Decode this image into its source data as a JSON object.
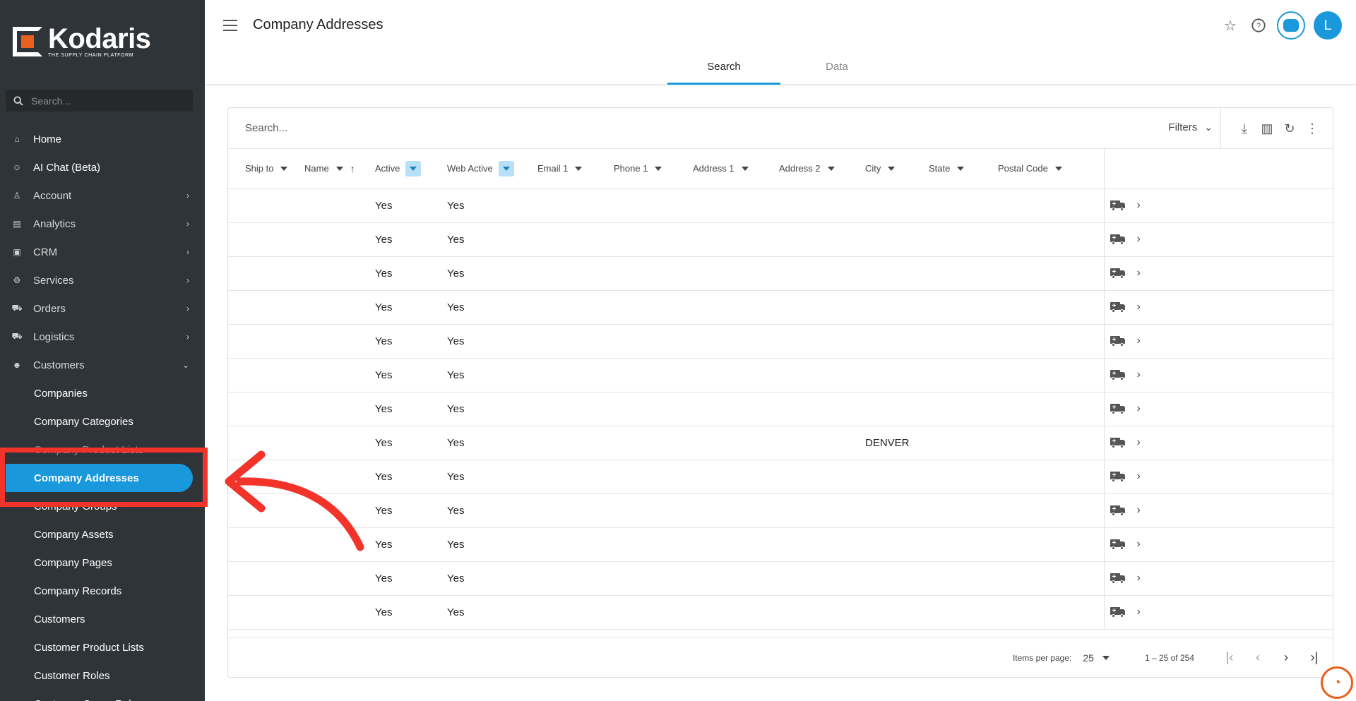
{
  "brand": {
    "name": "Kodaris",
    "tagline": "THE SUPPLY CHAIN PLATFORM",
    "accent": "#1a98dc",
    "logo_orange": "#e8611c"
  },
  "sidebar": {
    "search_placeholder": "Search...",
    "items": [
      {
        "label": "Home",
        "icon": "home-icon",
        "chevron": false
      },
      {
        "label": "AI Chat (Beta)",
        "icon": "robot-icon",
        "chevron": false
      },
      {
        "label": "Account",
        "icon": "person-icon",
        "chevron": true
      },
      {
        "label": "Analytics",
        "icon": "analytics-icon",
        "chevron": true
      },
      {
        "label": "CRM",
        "icon": "contact-icon",
        "chevron": true
      },
      {
        "label": "Services",
        "icon": "gears-icon",
        "chevron": true
      },
      {
        "label": "Orders",
        "icon": "truck-icon",
        "chevron": true
      },
      {
        "label": "Logistics",
        "icon": "shipping-icon",
        "chevron": true
      },
      {
        "label": "Customers",
        "icon": "people-icon",
        "chevron": true,
        "expanded": true
      }
    ],
    "sub_items": [
      {
        "label": "Companies"
      },
      {
        "label": "Company Categories"
      },
      {
        "label": "Company Product Lists"
      },
      {
        "label": "Company Addresses",
        "active": true
      },
      {
        "label": "Company Groups"
      },
      {
        "label": "Company Assets"
      },
      {
        "label": "Company Pages"
      },
      {
        "label": "Company Records"
      },
      {
        "label": "Customers"
      },
      {
        "label": "Customer Product Lists"
      },
      {
        "label": "Customer Roles"
      },
      {
        "label": "Customer Group Roles"
      }
    ]
  },
  "header": {
    "title": "Company Addresses",
    "avatar_letter": "L",
    "icons": [
      "star-icon",
      "help-icon",
      "robot-icon"
    ]
  },
  "tabs": [
    {
      "label": "Search",
      "active": true
    },
    {
      "label": "Data",
      "active": false
    }
  ],
  "table": {
    "search_placeholder": "Search...",
    "filters_label": "Filters",
    "columns": [
      "Ship to",
      "Name",
      "Active",
      "Web Active",
      "Email 1",
      "Phone 1",
      "Address 1",
      "Address 2",
      "City",
      "State",
      "Postal Code"
    ],
    "rows": [
      {
        "active": "Yes",
        "web_active": "Yes",
        "city": ""
      },
      {
        "active": "Yes",
        "web_active": "Yes",
        "city": ""
      },
      {
        "active": "Yes",
        "web_active": "Yes",
        "city": ""
      },
      {
        "active": "Yes",
        "web_active": "Yes",
        "city": ""
      },
      {
        "active": "Yes",
        "web_active": "Yes",
        "city": ""
      },
      {
        "active": "Yes",
        "web_active": "Yes",
        "city": ""
      },
      {
        "active": "Yes",
        "web_active": "Yes",
        "city": ""
      },
      {
        "active": "Yes",
        "web_active": "Yes",
        "city": "DENVER"
      },
      {
        "active": "Yes",
        "web_active": "Yes",
        "city": ""
      },
      {
        "active": "Yes",
        "web_active": "Yes",
        "city": ""
      },
      {
        "active": "Yes",
        "web_active": "Yes",
        "city": ""
      },
      {
        "active": "Yes",
        "web_active": "Yes",
        "city": ""
      },
      {
        "active": "Yes",
        "web_active": "Yes",
        "city": ""
      }
    ]
  },
  "paginator": {
    "items_per_page_label": "Items per page:",
    "items_per_page": "25",
    "range": "1 – 25 of 254"
  },
  "annotation": {
    "color": "#f2332a"
  }
}
